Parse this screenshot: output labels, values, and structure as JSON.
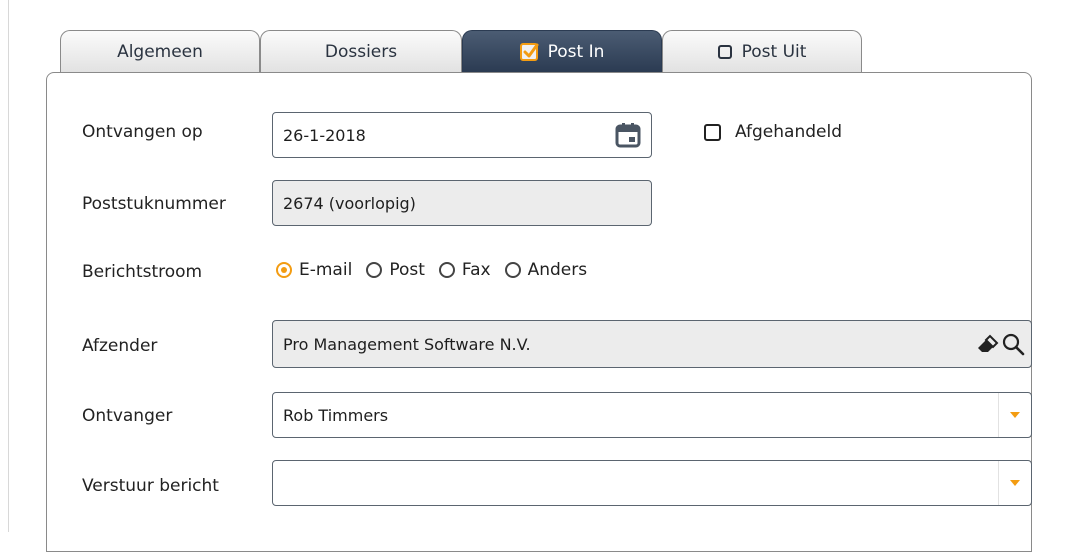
{
  "tabs": [
    {
      "label": "Algemeen",
      "active": false
    },
    {
      "label": "Dossiers",
      "active": false
    },
    {
      "label": "Post In",
      "active": true,
      "checked": true
    },
    {
      "label": "Post Uit",
      "active": false,
      "checked": false
    }
  ],
  "form": {
    "received_label": "Ontvangen op",
    "received_value": "26-1-2018",
    "handled_label": "Afgehandeld",
    "handled_checked": false,
    "number_label": "Poststuknummer",
    "number_value": "2674 (voorlopig)",
    "channel_label": "Berichtstroom",
    "channel_options": [
      "E-mail",
      "Post",
      "Fax",
      "Anders"
    ],
    "channel_selected": "E-mail",
    "sender_label": "Afzender",
    "sender_value": "Pro Management Software N.V.",
    "recipient_label": "Ontvanger",
    "recipient_value": "Rob Timmers",
    "send_label": "Verstuur bericht",
    "send_value": ""
  },
  "colors": {
    "accent": "#f39c12",
    "active_tab": "#2b3b52",
    "readonly_bg": "#ececec"
  },
  "icons": [
    "calendar-icon",
    "eraser-icon",
    "search-icon",
    "chevron-down-icon"
  ]
}
